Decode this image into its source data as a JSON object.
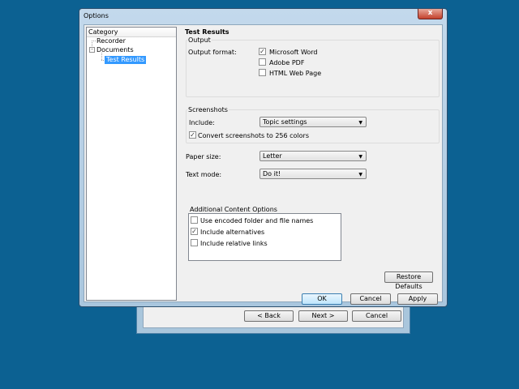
{
  "wizard": {
    "back_label": "< Back",
    "next_label": "Next >",
    "cancel_label": "Cancel"
  },
  "dialog": {
    "title": "Options",
    "close_glyph": "x"
  },
  "tree": {
    "header": "Category",
    "items": [
      {
        "label": "Recorder"
      },
      {
        "label": "Documents",
        "expander": "-"
      },
      {
        "label": "Test Results"
      }
    ]
  },
  "panel": {
    "title": "Test Results",
    "output": {
      "group_label": "Output",
      "format_label": "Output format:",
      "formats": [
        {
          "label": "Microsoft Word",
          "checked": true
        },
        {
          "label": "Adobe PDF",
          "checked": false
        },
        {
          "label": "HTML Web Page",
          "checked": false
        }
      ]
    },
    "screenshots": {
      "group_label": "Screenshots",
      "include_label": "Include:",
      "include_value": "Topic settings",
      "convert_label": "Convert screenshots to 256 colors",
      "convert_checked": true
    },
    "paper_size": {
      "label": "Paper size:",
      "value": "Letter"
    },
    "text_mode": {
      "label": "Text mode:",
      "value": "Do it!"
    },
    "additional": {
      "label": "Additional Content Options",
      "items": [
        {
          "label": "Use encoded folder and file names",
          "checked": false
        },
        {
          "label": "Include alternatives",
          "checked": true
        },
        {
          "label": "Include relative links",
          "checked": false
        }
      ]
    },
    "restore_label": "Restore Defaults"
  },
  "buttons": {
    "ok": "OK",
    "cancel": "Cancel",
    "apply": "Apply"
  },
  "check_glyph": "✓",
  "dropdown_glyph": "▼"
}
